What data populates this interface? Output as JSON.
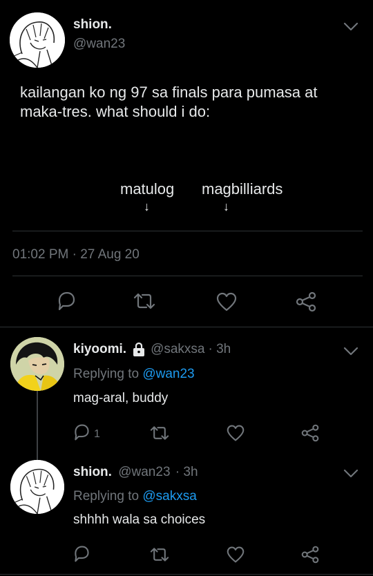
{
  "main_tweet": {
    "author_name": "shion.",
    "handle": "@wan23",
    "text_line1": "kailangan ko ng 97 sa finals para pumasa at",
    "text_line2": "maka-tres. what should i do:",
    "choices": [
      {
        "label": "matulog",
        "arrow": "↓"
      },
      {
        "label": "magbilliards",
        "arrow": "↓"
      }
    ],
    "timestamp": "01:02 PM · 27 Aug 20"
  },
  "replies": [
    {
      "author_name": "kiyoomi.",
      "protected_icon": "lock-icon",
      "handle": "@sakxsa",
      "time": "· 3h",
      "replying_prefix": "Replying to",
      "replying_to": "@wan23",
      "text": "mag-aral, buddy",
      "reply_count": "1"
    },
    {
      "author_name": "shion.",
      "handle": "@wan23",
      "time": "· 3h",
      "replying_prefix": "Replying to",
      "replying_to": "@sakxsa",
      "text": "shhhh wala sa choices",
      "reply_count": ""
    }
  ],
  "icons": {
    "reply": "reply-icon",
    "retweet": "retweet-icon",
    "like": "heart-icon",
    "share": "share-icon",
    "more": "chevron-down-icon"
  },
  "colors": {
    "background": "#000000",
    "text": "#e7e9ea",
    "muted": "#71767b",
    "link": "#1d9bf0",
    "divider": "#2f3336"
  }
}
